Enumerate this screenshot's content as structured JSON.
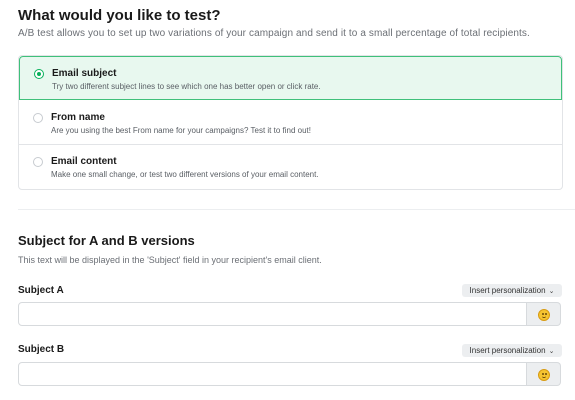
{
  "test_section": {
    "title": "What would you like to test?",
    "description": "A/B test allows you to set up two variations of your campaign and send it to a small percentage of total recipients.",
    "options": [
      {
        "title": "Email subject",
        "description": "Try two different subject lines to see which one has better open or click rate.",
        "selected": true
      },
      {
        "title": "From name",
        "description": "Are you using the best From name for your campaigns? Test it to find out!",
        "selected": false
      },
      {
        "title": "Email content",
        "description": "Make one small change, or test two different versions of your email content.",
        "selected": false
      }
    ]
  },
  "subject_section": {
    "title": "Subject for A and B versions",
    "description": "This text will be displayed in the 'Subject' field in your recipient's email client.",
    "subject_a": {
      "label": "Subject A",
      "value": "",
      "personalization_label": "Insert personalization"
    },
    "subject_b": {
      "label": "Subject B",
      "value": "",
      "personalization_label": "Insert personalization"
    }
  },
  "icons": {
    "radio_selected_color": "#09b05b",
    "emoji_button_icon": "smiley-emoji-icon",
    "chevron_icon": "chevron-down-icon"
  }
}
